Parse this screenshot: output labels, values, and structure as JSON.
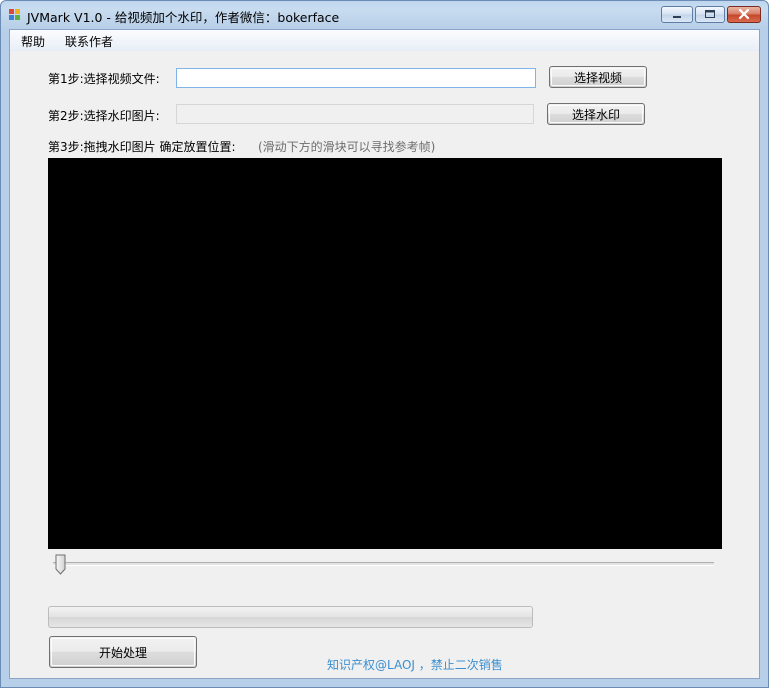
{
  "window": {
    "title": "JVMark V1.0 - 给视频加个水印，作者微信：bokerface"
  },
  "menu": {
    "items": [
      "帮助",
      "联系作者"
    ]
  },
  "step1": {
    "label": "第1步:选择视频文件:",
    "value": "",
    "button": "选择视频"
  },
  "step2": {
    "label": "第2步:选择水印图片:",
    "value": "",
    "button": "选择水印"
  },
  "step3": {
    "label": "第3步:拖拽水印图片 确定放置位置:",
    "hint": "(滑动下方的滑块可以寻找参考帧)"
  },
  "frame_slider": {
    "value": 0
  },
  "progress": {
    "value": 0
  },
  "start_button": "开始处理",
  "footer": "知识产权@LAOJ ，禁止二次销售",
  "colors": {
    "titlebar": "#c4d9ef",
    "client_bg": "#f0f0f0",
    "preview_bg": "#000000",
    "footer_text": "#3b8fd0",
    "close_button": "#c5442a"
  }
}
